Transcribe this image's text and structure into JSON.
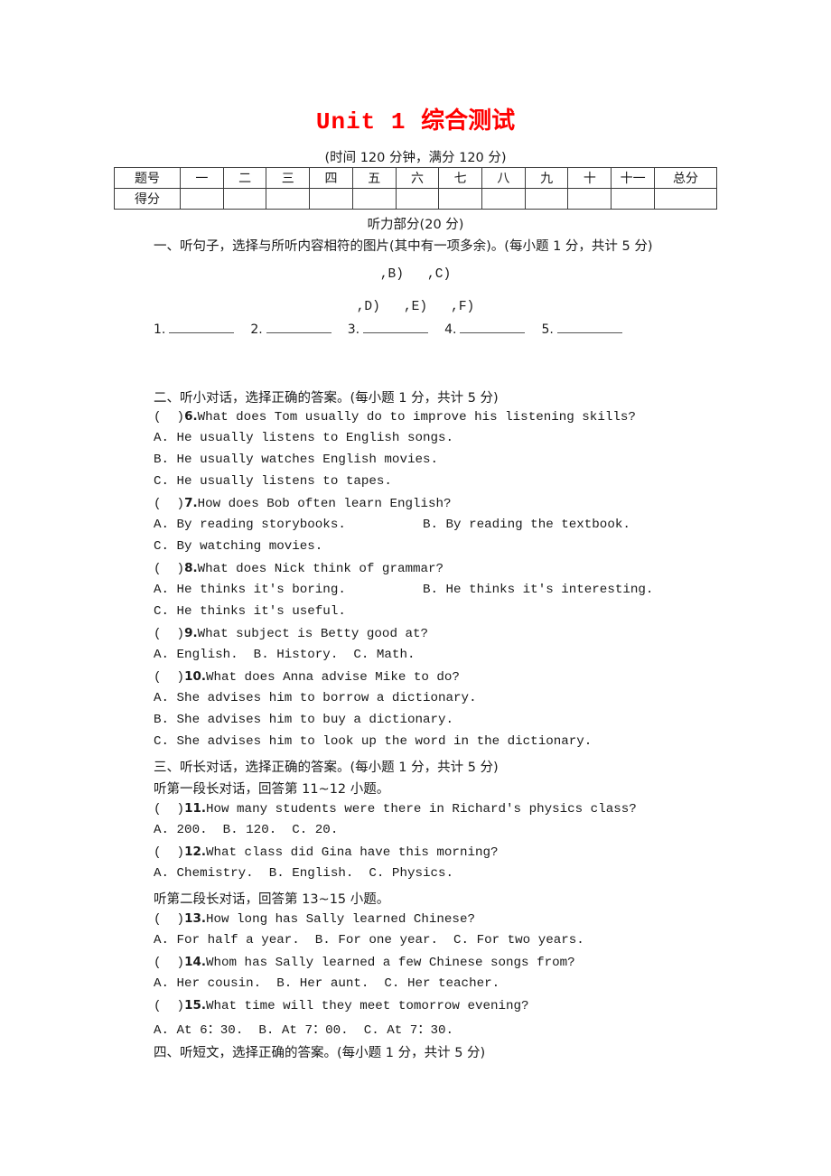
{
  "document": {
    "title_en": "Unit 1",
    "title_cn": "综合测试",
    "subtitle": "(时间 120 分钟，满分 120 分)",
    "title_color": "#ff0000"
  },
  "score_table": {
    "row_labels": [
      "题号",
      "得分"
    ],
    "columns": [
      "一",
      "二",
      "三",
      "四",
      "五",
      "六",
      "七",
      "八",
      "九",
      "十",
      "十一"
    ],
    "total_label": "总分"
  },
  "part_heading": "听力部分(20 分)",
  "sections": [
    {
      "id": "section-1",
      "heading": "一、听句子，选择与所听内容相符的图片(其中有一项多余)。(每小题 1 分，共计 5 分)",
      "picture_marks_row1": ",B)   ,C)",
      "picture_marks_row2": ",D)   ,E)   ,F)",
      "answer_blanks": [
        "1.",
        "2.",
        "3.",
        "4.",
        "5."
      ]
    },
    {
      "id": "section-2",
      "heading": "二、听小对话，选择正确的答案。(每小题 1 分，共计 5 分)",
      "items": [
        {
          "marker": "(  )",
          "number": "6.",
          "stem": "What does Tom usually do to improve his listening skills?",
          "options": [
            "A. He usually listens to English songs.",
            "B. He usually watches English movies.",
            "C. He usually listens to tapes."
          ]
        },
        {
          "marker": "(  )",
          "number": "7.",
          "stem": "How does Bob often learn English?",
          "options": [
            "A. By reading storybooks.          B. By reading the textbook.",
            "C. By watching movies."
          ]
        },
        {
          "marker": "(  )",
          "number": "8.",
          "stem": "What does Nick think of grammar?",
          "options": [
            "A. He thinks it's boring.          B. He thinks it's interesting.",
            "C. He thinks it's useful."
          ]
        },
        {
          "marker": "(  )",
          "number": "9.",
          "stem": "What subject is Betty good at?",
          "options": [
            "A. English.  B. History.  C. Math."
          ]
        },
        {
          "marker": "(  )",
          "number": "10.",
          "stem": "What does Anna advise Mike to do?",
          "options": [
            "A. She advises him to borrow a dictionary.",
            "B. She advises him to buy a dictionary.",
            "C. She advises him to look up the word in the dictionary."
          ]
        }
      ]
    },
    {
      "id": "section-3",
      "heading": "三、听长对话，选择正确的答案。(每小题 1 分，共计 5 分)",
      "sub_heading_1": "听第一段长对话，回答第 11~12 小题。",
      "sub_heading_2": "听第二段长对话，回答第 13~15 小题。",
      "items": [
        {
          "marker": "(  )",
          "number": "11.",
          "stem": "How many students were there in Richard's physics class?",
          "options": [
            "A. 200.  B. 120.  C. 20."
          ]
        },
        {
          "marker": "(  )",
          "number": "12.",
          "stem": "What class did Gina have this morning?",
          "options": [
            "A. Chemistry.  B. English.  C. Physics."
          ]
        },
        {
          "marker": "(  )",
          "number": "13.",
          "stem": "How long has Sally learned Chinese?",
          "options": [
            "A. For half a year.  B. For one year.  C. For two years."
          ]
        },
        {
          "marker": "(  )",
          "number": "14.",
          "stem": "Whom has Sally learned a few Chinese songs from?",
          "options": [
            "A. Her cousin.  B. Her aunt.  C. Her teacher."
          ]
        },
        {
          "marker": "(  )",
          "number": "15.",
          "stem": "What time will they meet tomorrow evening?",
          "options": [
            "A. At 6：30.  B. At 7：00.  C. At 7：30."
          ]
        }
      ]
    },
    {
      "id": "section-4",
      "heading": "四、听短文，选择正确的答案。(每小题 1 分，共计 5 分)"
    }
  ]
}
